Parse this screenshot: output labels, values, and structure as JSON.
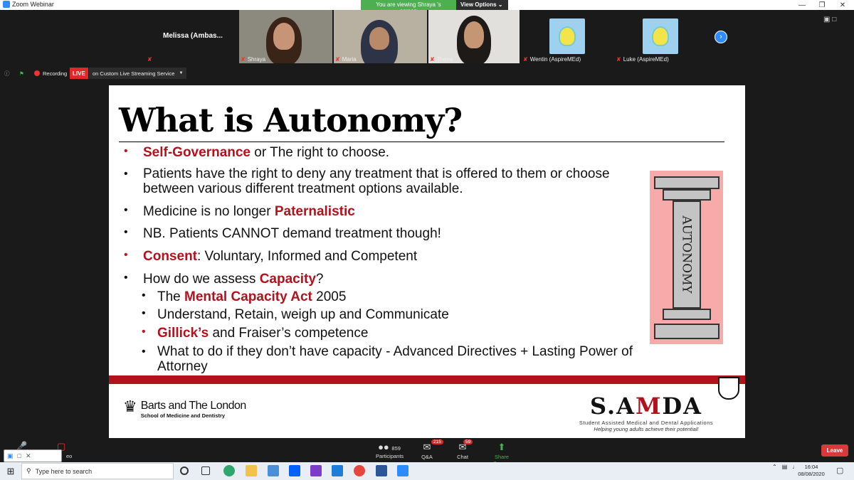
{
  "window": {
    "title": "Zoom Webinar"
  },
  "banner": {
    "viewing": "You are viewing Shraya 's screen",
    "options": "View Options ⌄"
  },
  "participants_strip": [
    {
      "name": "Melissa  (Ambas...",
      "type": "name-only"
    },
    {
      "name": "Shraya",
      "type": "video"
    },
    {
      "name": "Maria",
      "type": "video"
    },
    {
      "name": "Theno",
      "type": "video"
    },
    {
      "name": "Wentin (AspireMEd)",
      "type": "logo"
    },
    {
      "name": "Luke (AspireMEd)",
      "type": "logo"
    }
  ],
  "recording": {
    "label": "Recording",
    "live": "LIVE",
    "stream": "on Custom Live Streaming Service"
  },
  "slide": {
    "title": "What is Autonomy?",
    "bullets": [
      {
        "pre": "",
        "hl": "Self-Governance",
        "post": " or The right to choose.",
        "red_dot": true
      },
      {
        "pre": "Patients have the right to deny any treatment that is offered to them or choose between various different treatment options available.",
        "hl": "",
        "post": "",
        "red_dot": false
      },
      {
        "pre": "Medicine is no longer ",
        "hl": "Paternalistic",
        "post": "",
        "red_dot": false
      },
      {
        "pre": "NB. Patients CANNOT demand treatment though!",
        "hl": "",
        "post": "",
        "red_dot": false
      },
      {
        "pre": "",
        "hl": "Consent",
        "post": ": Voluntary, Informed and Competent",
        "red_dot": true
      },
      {
        "pre": "How do we assess ",
        "hl": "Capacity",
        "post": "?",
        "red_dot": false
      }
    ],
    "sub_bullets": [
      {
        "pre": "The ",
        "hl": "Mental Capacity Act",
        "post": " 2005",
        "red_dot": false
      },
      {
        "pre": "Understand, Retain, weigh up and Communicate",
        "hl": "",
        "post": "",
        "red_dot": false
      },
      {
        "pre": "",
        "hl": "Gillick’s",
        "post": " and Fraiser’s competence",
        "red_dot": true
      },
      {
        "pre": "What to do if they don’t have capacity - Advanced Directives + Lasting Power of Attorney",
        "hl": "",
        "post": "",
        "red_dot": false
      }
    ],
    "pillar_text": "AUTONOMY",
    "barts_line1": "Barts and The London",
    "barts_line2": "School of Medicine and Dentistry",
    "samda_logo_a": "S.A",
    "samda_logo_b": "M",
    "samda_logo_c": "DA",
    "samda_line1": "Student Assisted Medical and Dental Applications",
    "samda_line2": "Helping young adults achieve their potential!"
  },
  "toolbar": {
    "participants_count": "859",
    "participants_label": "Participants",
    "qa_label": "Q&A",
    "qa_badge": "215",
    "chat_label": "Chat",
    "chat_badge": "59",
    "share_label": "Share Screen",
    "leave_label": "Leave",
    "video_label": "eo"
  },
  "taskbar": {
    "search_placeholder": "Type here to search",
    "time": "16:04",
    "date": "08/08/2020"
  },
  "colors": {
    "accent_red": "#b3111c",
    "zoom_blue": "#2d8cff",
    "share_green": "#4caf50"
  }
}
